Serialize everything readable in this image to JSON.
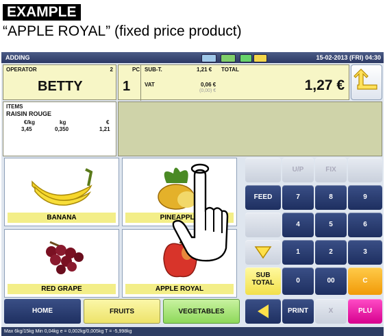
{
  "doc": {
    "badge": "EXAMPLE",
    "caption": "“APPLE ROYAL” (fixed price product)"
  },
  "title_bar": {
    "mode": "ADDING",
    "datetime": "15-02-2013 (FRI) 04:30"
  },
  "operator": {
    "label": "OPERATOR",
    "number": "2",
    "name": "BETTY"
  },
  "counts": {
    "pc_label": "PC",
    "pc_value": "1",
    "subtotal_label": "SUB-T.",
    "subtotal_value": "1,21 €",
    "vat_label": "VAT",
    "vat_value": "0,06 €",
    "vat_sub": "(0,00) €",
    "total_label": "TOTAL",
    "total_value": "1,27 €"
  },
  "items": {
    "header": "ITEMS",
    "name": "RAISIN ROUGE",
    "col_labels": [
      "€/kg",
      "kg",
      "€"
    ],
    "col_values": [
      "3,45",
      "0,350",
      "1,21"
    ]
  },
  "products": [
    {
      "name": "BANANA"
    },
    {
      "name": "PINEAPPLE"
    },
    {
      "name": "RED GRAPE"
    },
    {
      "name": "APPLE ROYAL"
    }
  ],
  "keypad": {
    "up": "U/P",
    "fix": "FIX",
    "feed": "FEED",
    "k7": "7",
    "k8": "8",
    "k9": "9",
    "k4": "4",
    "k5": "5",
    "k6": "6",
    "k1": "1",
    "k2": "2",
    "k3": "3",
    "sub_total_1": "SUB",
    "sub_total_2": "TOTAL",
    "k0": "0",
    "k00": "00",
    "clear": "C",
    "print": "PRINT",
    "x": "X",
    "plu": "PLU"
  },
  "bottom": {
    "home": "HOME",
    "fruits": "FRUITS",
    "vegetables": "VEGETABLES"
  },
  "status": "Max 6kg/15kg  Min 0,04kg  e = 0,002kg/0,005kg  T = -5,998kg",
  "colors": {
    "title_bar": "#2c3964",
    "panel": "#f7f6c6",
    "accent": "#f19a08",
    "plu": "#d6008e"
  }
}
